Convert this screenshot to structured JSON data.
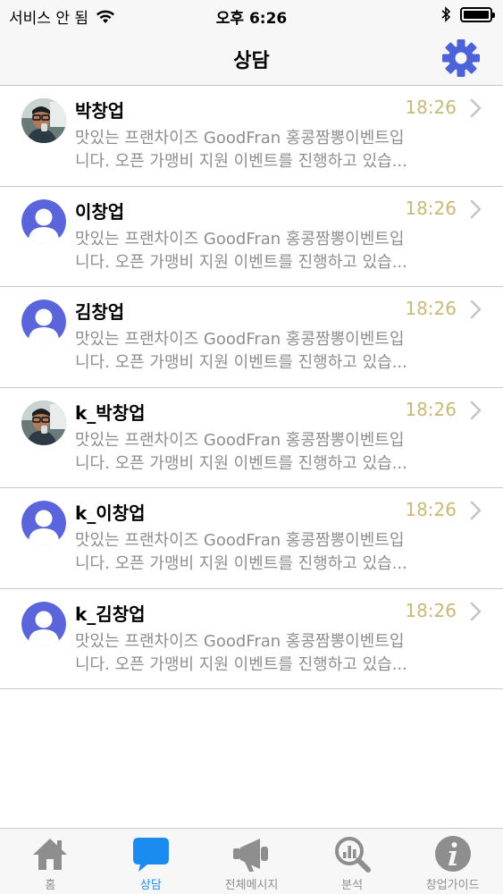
{
  "status_bar": {
    "carrier": "서비스 안 됨",
    "time": "오후 6:26"
  },
  "nav": {
    "title": "상담",
    "settings_icon": "gear-icon",
    "accent": "#4b62d8"
  },
  "conversations": [
    {
      "name": "박창업",
      "time": "18:26",
      "avatar": "photo",
      "preview": "맛있는 프랜차이즈 GoodFran 홍콩짬뽕이벤트입\n니다. 오픈 가맹비 지원 이벤트를 진행하고 있습..."
    },
    {
      "name": "이창업",
      "time": "18:26",
      "avatar": "default",
      "preview": "맛있는 프랜차이즈 GoodFran 홍콩짬뽕이벤트입\n니다. 오픈 가맹비 지원 이벤트를 진행하고 있습..."
    },
    {
      "name": "김창업",
      "time": "18:26",
      "avatar": "default",
      "preview": "맛있는 프랜차이즈 GoodFran 홍콩짬뽕이벤트입\n니다. 오픈 가맹비 지원 이벤트를 진행하고 있습..."
    },
    {
      "name": "k_박창업",
      "time": "18:26",
      "avatar": "photo",
      "preview": "맛있는 프랜차이즈 GoodFran 홍콩짬뽕이벤트입\n니다. 오픈 가맹비 지원 이벤트를 진행하고 있습..."
    },
    {
      "name": "k_이창업",
      "time": "18:26",
      "avatar": "default",
      "preview": "맛있는 프랜차이즈 GoodFran 홍콩짬뽕이벤트입\n니다. 오픈 가맹비 지원 이벤트를 진행하고 있습..."
    },
    {
      "name": "k_김창업",
      "time": "18:26",
      "avatar": "default",
      "preview": "맛있는 프랜차이즈 GoodFran 홍콩짬뽕이벤트입\n니다. 오픈 가맹비 지원 이벤트를 진행하고 있습..."
    }
  ],
  "tabs": [
    {
      "label": "홈",
      "icon": "home-icon",
      "active": false
    },
    {
      "label": "상담",
      "icon": "chat-bubble-icon",
      "active": true
    },
    {
      "label": "전체메시지",
      "icon": "megaphone-icon",
      "active": false
    },
    {
      "label": "분석",
      "icon": "analytics-magnifier-icon",
      "active": false
    },
    {
      "label": "창업가이드",
      "icon": "info-icon",
      "active": false
    }
  ],
  "colors": {
    "time": "#c8b97a",
    "tab_active": "#1b8bf0",
    "tab_inactive": "#8e8e8e",
    "avatar_default": "#5a64db"
  }
}
